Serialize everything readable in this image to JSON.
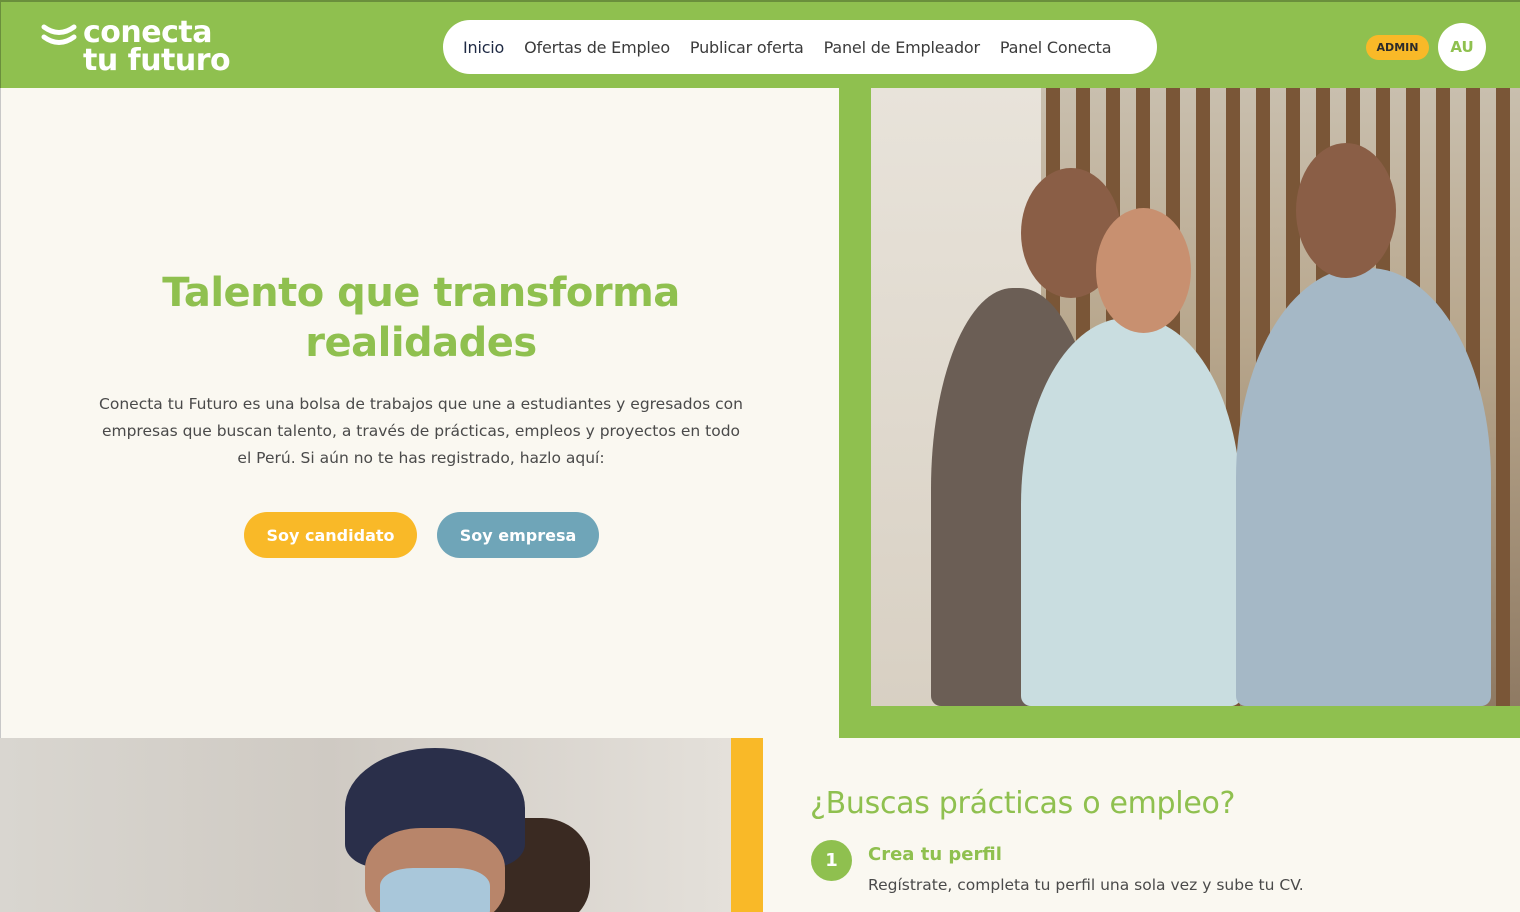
{
  "header": {
    "logo_line1": "conecta",
    "logo_line2": "tu futuro",
    "nav": [
      {
        "label": "Inicio",
        "active": true
      },
      {
        "label": "Ofertas de Empleo",
        "active": false
      },
      {
        "label": "Publicar oferta",
        "active": false
      },
      {
        "label": "Panel de Empleador",
        "active": false
      },
      {
        "label": "Panel Conecta",
        "active": false
      }
    ],
    "admin_badge": "ADMIN",
    "avatar_initials": "AU"
  },
  "hero": {
    "title": "Talento que transforma realidades",
    "description": "Conecta tu Futuro es una bolsa de trabajos que une a estudiantes y egresados con empresas que buscan talento, a través de prácticas, empleos y proyectos en todo el Perú. Si aún no te has registrado, hazlo aquí:",
    "btn_candidate": "Soy candidato",
    "btn_company": "Soy empresa"
  },
  "steps": {
    "title": "¿Buscas prácticas o empleo?",
    "items": [
      {
        "number": "1",
        "title": "Crea tu perfil",
        "description": "Regístrate, completa tu perfil una sola vez y sube tu CV."
      }
    ]
  },
  "colors": {
    "brand_green": "#8fc04f",
    "accent_yellow": "#f9b928",
    "accent_blue": "#6fa5b8",
    "background": "#faf8f1"
  }
}
